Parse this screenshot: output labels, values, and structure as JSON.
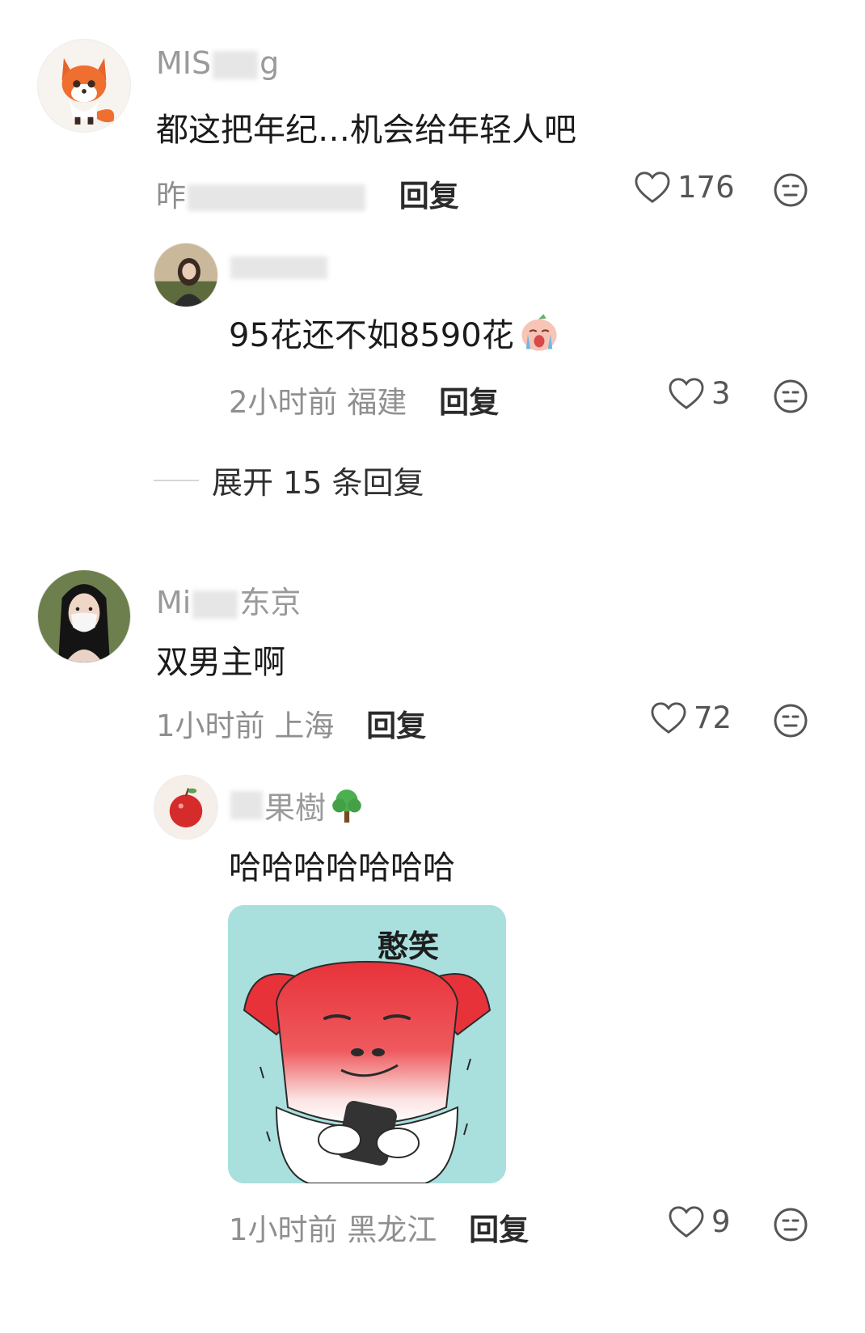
{
  "comments": [
    {
      "username_visible": "MIS",
      "username_tail": "g",
      "text": "都这把年纪…机会给年轻人吧",
      "time": "昨",
      "location": "",
      "reply": "回复",
      "likes": "176",
      "replies": [
        {
          "username_visible": "",
          "text": "95花还不如8590花",
          "time": "2小时前",
          "location": "福建",
          "reply": "回复",
          "likes": "3"
        }
      ],
      "expand_label": "展开 15 条回复"
    },
    {
      "username_visible": "Mi",
      "username_tail": "东京",
      "text": "双男主啊",
      "time": "1小时前",
      "location": "上海",
      "reply": "回复",
      "likes": "72",
      "replies": [
        {
          "username_visible": "",
          "username_tail": "果樹",
          "text": "哈哈哈哈哈哈哈",
          "sticker_caption": "憨笑",
          "time": "1小时前",
          "location": "黑龙江",
          "reply": "回复",
          "likes": "9"
        }
      ]
    }
  ],
  "colors": {
    "username": "#9a9a9a",
    "meta": "#8f8f8f",
    "sticker_bg": "#a9e0de",
    "pig_red": "#e8323a"
  },
  "icons": {
    "like": "heart-outline-icon",
    "dislike": "meh-face-icon"
  }
}
